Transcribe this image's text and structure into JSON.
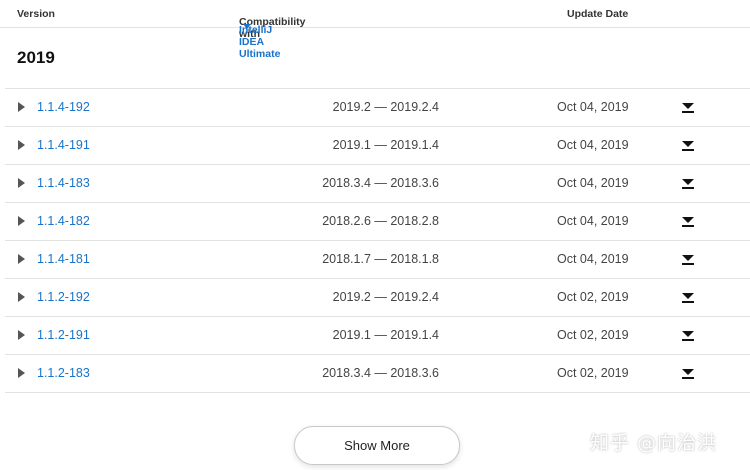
{
  "header": {
    "version": "Version",
    "compat_prefix": "Compatibility with",
    "compat_product": "IntelliJ IDEA Ultimate",
    "update_date": "Update Date"
  },
  "year": "2019",
  "rows": [
    {
      "version": "1.1.4-192",
      "compat": "2019.2 — 2019.2.4",
      "date": "Oct 04, 2019"
    },
    {
      "version": "1.1.4-191",
      "compat": "2019.1 — 2019.1.4",
      "date": "Oct 04, 2019"
    },
    {
      "version": "1.1.4-183",
      "compat": "2018.3.4 — 2018.3.6",
      "date": "Oct 04, 2019"
    },
    {
      "version": "1.1.4-182",
      "compat": "2018.2.6 — 2018.2.8",
      "date": "Oct 04, 2019"
    },
    {
      "version": "1.1.4-181",
      "compat": "2018.1.7 — 2018.1.8",
      "date": "Oct 04, 2019"
    },
    {
      "version": "1.1.2-192",
      "compat": "2019.2 — 2019.2.4",
      "date": "Oct 02, 2019"
    },
    {
      "version": "1.1.2-191",
      "compat": "2019.1 — 2019.1.4",
      "date": "Oct 02, 2019"
    },
    {
      "version": "1.1.2-183",
      "compat": "2018.3.4 — 2018.3.6",
      "date": "Oct 02, 2019"
    }
  ],
  "show_more": "Show More",
  "watermark": "知乎 @向治洪",
  "colors": {
    "link": "#1a73c8",
    "text": "#333333",
    "divider": "#e2e2e2"
  },
  "icons": {
    "expand": "caret-right-icon",
    "download": "download-icon",
    "dropdown": "caret-down-icon"
  }
}
